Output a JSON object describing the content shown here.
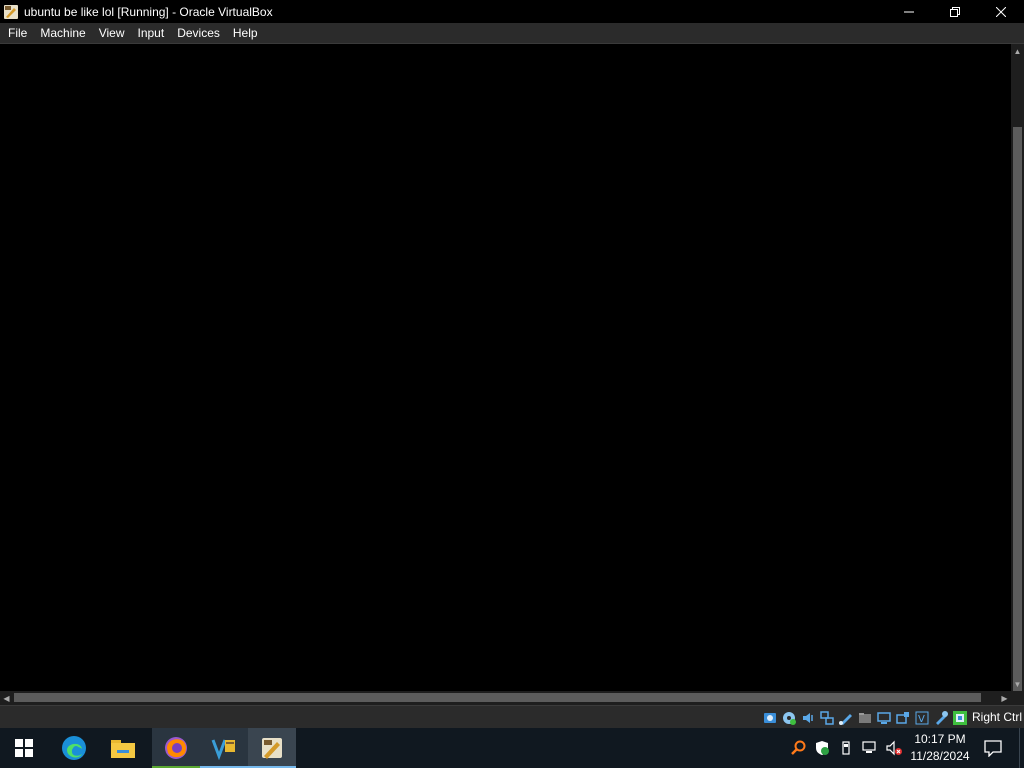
{
  "window": {
    "title": "ubuntu be like lol [Running] - Oracle VirtualBox",
    "controls": {
      "minimize": "minimize-icon",
      "maximize": "restore-icon",
      "close": "close-icon"
    }
  },
  "menu": {
    "items": [
      {
        "label": "File"
      },
      {
        "label": "Machine"
      },
      {
        "label": "View"
      },
      {
        "label": "Input"
      },
      {
        "label": "Devices"
      },
      {
        "label": "Help"
      }
    ]
  },
  "statusbar": {
    "icons": [
      "hard-disk-icon",
      "optical-drive-icon",
      "audio-icon",
      "network-icon",
      "usb-icon",
      "shared-folders-icon",
      "display-icon",
      "recording-icon",
      "vt-x-icon",
      "mouse-integration-icon",
      "keyboard-capture-icon"
    ],
    "host_key": "Right Ctrl"
  },
  "taskbar": {
    "apps": [
      {
        "name": "start-button",
        "icon": "windows-icon"
      },
      {
        "name": "edge",
        "icon": "edge-icon"
      },
      {
        "name": "file-explorer",
        "icon": "folder-icon"
      },
      {
        "name": "firefox",
        "icon": "firefox-icon"
      },
      {
        "name": "virtualbox-manager",
        "icon": "virtualbox-manager-icon"
      },
      {
        "name": "virtualbox-vm",
        "icon": "virtualbox-icon"
      }
    ],
    "tray_icons": [
      "search-icon",
      "defender-icon",
      "usb-eject-icon",
      "network-icon",
      "volume-muted-icon"
    ],
    "clock": {
      "time": "10:17 PM",
      "date": "11/28/2024"
    },
    "colors": {
      "active_underline": "#76b9ed",
      "firefox_underline": "#5aa832"
    }
  }
}
